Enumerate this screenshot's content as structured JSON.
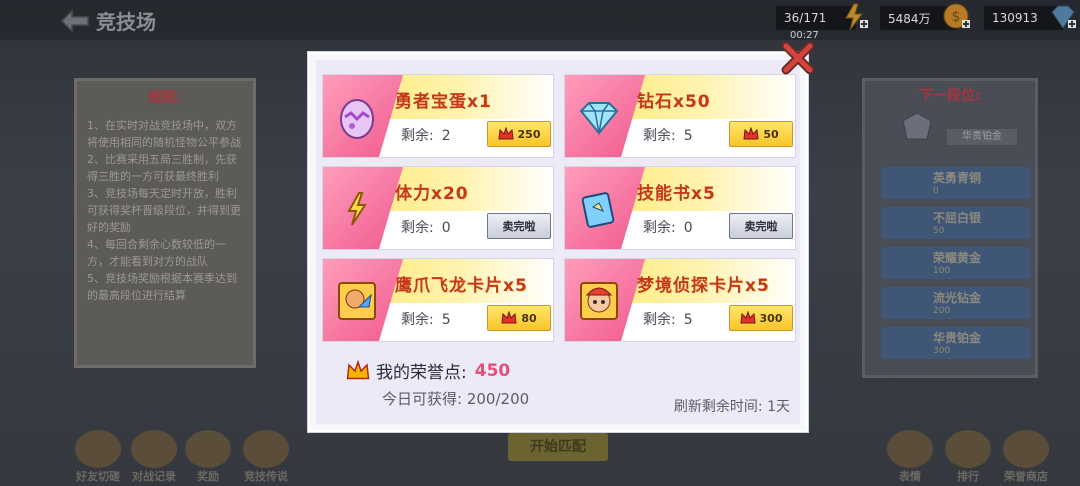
{
  "header": {
    "title": "竞技场",
    "stamina": "36/171",
    "timer": "00:27",
    "gold": "5484万",
    "diamonds": "130913"
  },
  "rules": {
    "title": "规则:",
    "lines": [
      "1、在实时对战竞技场中，双方将使用相同的随机怪物公平参战",
      "2、比赛采用五局三胜制，先获得三胜的一方可获最终胜利",
      "3、竞技场每天定时开放，胜利可获得奖杯晋级段位，并得到更好的奖励",
      "4、每回合剩余心数较低的一方，才能看到对方的战队",
      "5、竞技场奖励根据本赛季达到的最高段位进行结算"
    ]
  },
  "next_rank": {
    "title": "下一段位:",
    "current": "华贵铂金",
    "ranks": [
      {
        "name": "英勇青铜",
        "cups": "0"
      },
      {
        "name": "不屈白银",
        "cups": "50"
      },
      {
        "name": "荣耀黄金",
        "cups": "100"
      },
      {
        "name": "流光钻金",
        "cups": "200"
      },
      {
        "name": "华贵铂金",
        "cups": "300"
      }
    ]
  },
  "bottom": {
    "buttons": [
      "好友切磋",
      "对战记录",
      "奖励",
      "竞技传说"
    ],
    "right_buttons": [
      "表情",
      "排行",
      "荣誉商店"
    ],
    "start": "开始匹配"
  },
  "shop": {
    "items": [
      {
        "name": "勇者宝蛋x1",
        "remain_label": "剩余:",
        "remain": "2",
        "price": "250",
        "sold_out": false,
        "icon": "egg-icon"
      },
      {
        "name": "钻石x50",
        "remain_label": "剩余:",
        "remain": "5",
        "price": "50",
        "sold_out": false,
        "icon": "diamond-icon"
      },
      {
        "name": "体力x20",
        "remain_label": "剩余:",
        "remain": "0",
        "price": "卖完啦",
        "sold_out": true,
        "icon": "lightning-icon"
      },
      {
        "name": "技能书x5",
        "remain_label": "剩余:",
        "remain": "0",
        "price": "卖完啦",
        "sold_out": true,
        "icon": "skill-book-icon"
      },
      {
        "name": "鹰爪飞龙卡片x5",
        "remain_label": "剩余:",
        "remain": "5",
        "price": "80",
        "sold_out": false,
        "icon": "dragon-card-icon"
      },
      {
        "name": "梦境侦探卡片x5",
        "remain_label": "剩余:",
        "remain": "5",
        "price": "300",
        "sold_out": false,
        "icon": "detective-card-icon"
      }
    ],
    "honor_label": "我的荣誉点:",
    "honor_value": "450",
    "daily_label": "今日可获得:",
    "daily_value": "200/200",
    "refresh_label": "刷新剩余时间:",
    "refresh_value": "1天"
  },
  "colors": {
    "accent_pink": "#f26b97",
    "gold": "#f7c52a",
    "honor_value": "#e0507a",
    "title_red": "#c4371f"
  }
}
